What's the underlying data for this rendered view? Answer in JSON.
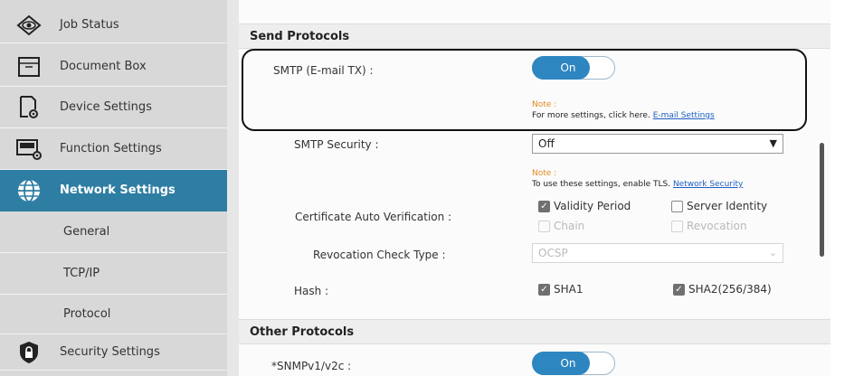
{
  "sidebar": {
    "items": [
      {
        "label": "Job Status",
        "icon": "eye-icon"
      },
      {
        "label": "Document Box",
        "icon": "folder-icon"
      },
      {
        "label": "Device Settings",
        "icon": "device-gear-icon"
      },
      {
        "label": "Function Settings",
        "icon": "printer-gear-icon"
      },
      {
        "label": "Network Settings",
        "icon": "globe-icon"
      },
      {
        "label": "General"
      },
      {
        "label": "TCP/IP"
      },
      {
        "label": "Protocol"
      },
      {
        "label": "Security Settings",
        "icon": "shield-lock-icon"
      }
    ],
    "active_color": "#2e7ea4"
  },
  "send_protocols": {
    "header": "Send Protocols",
    "smtp_label": "SMTP (E-mail TX) :",
    "smtp_toggle": "On",
    "note1_label": "Note :",
    "note1_text": "For more settings, click here.",
    "note1_link": "E-mail Settings",
    "smtp_security_label": "SMTP Security :",
    "smtp_security_value": "Off",
    "note2_label": "Note :",
    "note2_text": "To use these settings, enable TLS.",
    "note2_link": "Network Security",
    "cert_label": "Certificate Auto Verification :",
    "cert_options": [
      {
        "label": "Validity Period",
        "checked": true,
        "disabled": false
      },
      {
        "label": "Server Identity",
        "checked": false,
        "disabled": false
      },
      {
        "label": "Chain",
        "checked": false,
        "disabled": true
      },
      {
        "label": "Revocation",
        "checked": false,
        "disabled": true
      }
    ],
    "revocation_label": "Revocation Check Type :",
    "revocation_value": "OCSP",
    "hash_label": "Hash :",
    "hash_options": [
      {
        "label": "SHA1",
        "checked": true
      },
      {
        "label": "SHA2(256/384)",
        "checked": true
      }
    ]
  },
  "other_protocols": {
    "header": "Other Protocols",
    "snmp_label": "*SNMPv1/v2c :",
    "snmp_toggle": "On"
  }
}
